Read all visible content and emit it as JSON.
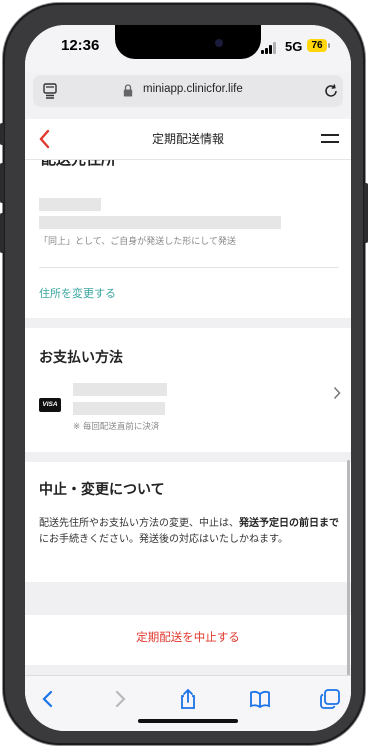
{
  "status_bar": {
    "time": "12:36",
    "network": "5G",
    "battery": "76"
  },
  "browser": {
    "url": "miniapp.clinicfor.life"
  },
  "header": {
    "title": "定期配送情報"
  },
  "address_section": {
    "title_cut": "配送先住所",
    "note": "「同上」として、ご自身が発送した形にして発送",
    "change_link": "住所を変更する"
  },
  "payment_section": {
    "title": "お支払い方法",
    "card_brand": "VISA",
    "note": "※ 毎回配送直前に決済"
  },
  "cancel_info_section": {
    "title": "中止・変更について",
    "text_1": "配送先住所やお支払い方法の変更、中止は、",
    "text_bold": "発送予定日の前日まで",
    "text_2": "にお手続きください。発送後の対応はいたしかねます。"
  },
  "cancel_button": {
    "label": "定期配送を中止する"
  },
  "colors": {
    "accent_red": "#e03a2e",
    "link_teal": "#3aa6a0",
    "battery_yellow": "#ffd60a"
  },
  "icons": {
    "browser_back": "chevron-left-icon",
    "browser_forward": "chevron-right-icon",
    "share": "share-icon",
    "bookmarks": "book-icon",
    "tabs": "tabs-icon"
  }
}
